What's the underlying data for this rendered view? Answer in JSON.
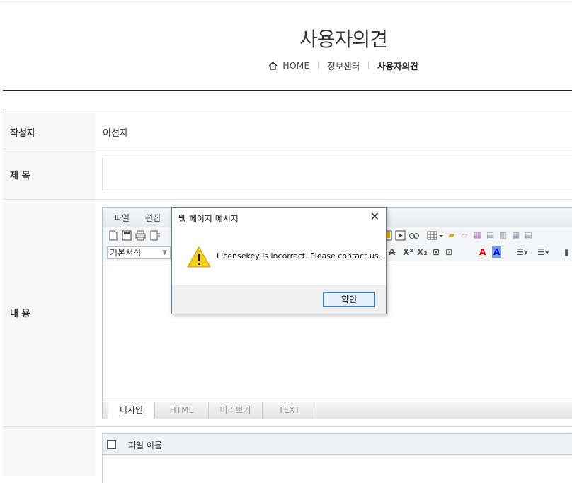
{
  "header": {
    "title": "사용자의견",
    "breadcrumb": {
      "home": "HOME",
      "section": "정보센터",
      "current": "사용자의견"
    }
  },
  "form": {
    "author_label": "작성자",
    "author_value": "이선자",
    "subject_label": "제 목",
    "subject_value": "",
    "content_label": "내 용"
  },
  "editor": {
    "menu": [
      "파일",
      "편집"
    ],
    "format_select": "기본서식",
    "tabs": [
      "디자인",
      "HTML",
      "미리보기",
      "TEXT"
    ],
    "active_tab": "디자인"
  },
  "attachments": {
    "column_header": "파일 이름"
  },
  "dialog": {
    "title": "웹 페이지 메시지",
    "message": "Licensekey is incorrect. Please contact us.",
    "ok_label": "확인",
    "close_glyph": "✕"
  }
}
